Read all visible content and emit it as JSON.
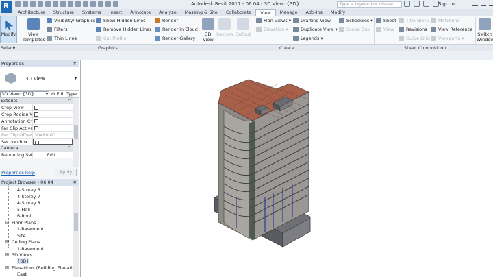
{
  "titlebar": {
    "logo": "R",
    "title": "Autodesk Revit 2017 -     06.04 - 3D View: {3D}",
    "search_placeholder": "Type a keyword or phrase",
    "signin": "Sign In"
  },
  "tabs": [
    "Architecture",
    "Structure",
    "Systems",
    "Insert",
    "Annotate",
    "Analyze",
    "Massing & Site",
    "Collaborate",
    "View",
    "Manage",
    "Add-Ins",
    "Modify"
  ],
  "active_tab": "View",
  "ribbon": {
    "modify": "Modify",
    "view_templates": "View Templates",
    "visibility": "Visibility/ Graphics",
    "filters": "Filters",
    "thin_lines": "Thin Lines",
    "show_hidden": "Show Hidden Lines",
    "remove_hidden": "Remove Hidden Lines",
    "cut_profile": "Cut Profile",
    "render": "Render",
    "render_cloud": "Render in Cloud",
    "render_gallery": "Render Gallery",
    "view3d": "3D View",
    "section": "Section",
    "callout": "Callout",
    "plan_views": "Plan Views",
    "elevation": "Elevation",
    "drafting_view": "Drafting View",
    "duplicate_view": "Duplicate View",
    "legends": "Legends",
    "schedules": "Schedules",
    "scope_box": "Scope Box",
    "sheet": "Sheet",
    "view": "View",
    "title_block": "Title Block",
    "revisions": "Revisions",
    "guide_grid": "Guide Grid",
    "matchline": "Matchline",
    "view_reference": "View Reference",
    "viewports": "Viewports",
    "switch_windows": "Switch Windows",
    "groups": {
      "select": "Select",
      "graphics": "Graphics",
      "create": "Create",
      "sheet_composition": "Sheet Composition"
    }
  },
  "properties": {
    "title": "Properties",
    "type_name": "3D View",
    "instance": "3D View: {3D}",
    "edit_type": "Edit Type",
    "category_extents": "Extents",
    "rows": [
      {
        "name": "Crop View",
        "value": ""
      },
      {
        "name": "Crop Region V...",
        "value": ""
      },
      {
        "name": "Annotation Cr...",
        "value": ""
      },
      {
        "name": "Far Clip Active",
        "value": ""
      },
      {
        "name": "Far Clip Offset",
        "value": "30480.00"
      },
      {
        "name": "Section Box",
        "value": ""
      }
    ],
    "category_camera": "Camera",
    "rendering_name": "Rendering Sett...",
    "rendering_value": "Edit...",
    "help": "Properties help",
    "apply": "Apply"
  },
  "browser": {
    "title": "Project Browser - 06.04",
    "items": [
      "4-Storey 6",
      "4-Storey 7",
      "4-Storey 8",
      "5-Hall",
      "6-Roof",
      "Floor Plans",
      "1-Basement",
      "Site",
      "Ceiling Plans",
      "1-Basement",
      "3D Views",
      "{3D}",
      "Elevations (Building Elevation",
      "East"
    ]
  },
  "colors": {
    "accent": "#1d6bb6",
    "selection": "#dbe7f5",
    "roof": "#a8604a"
  }
}
